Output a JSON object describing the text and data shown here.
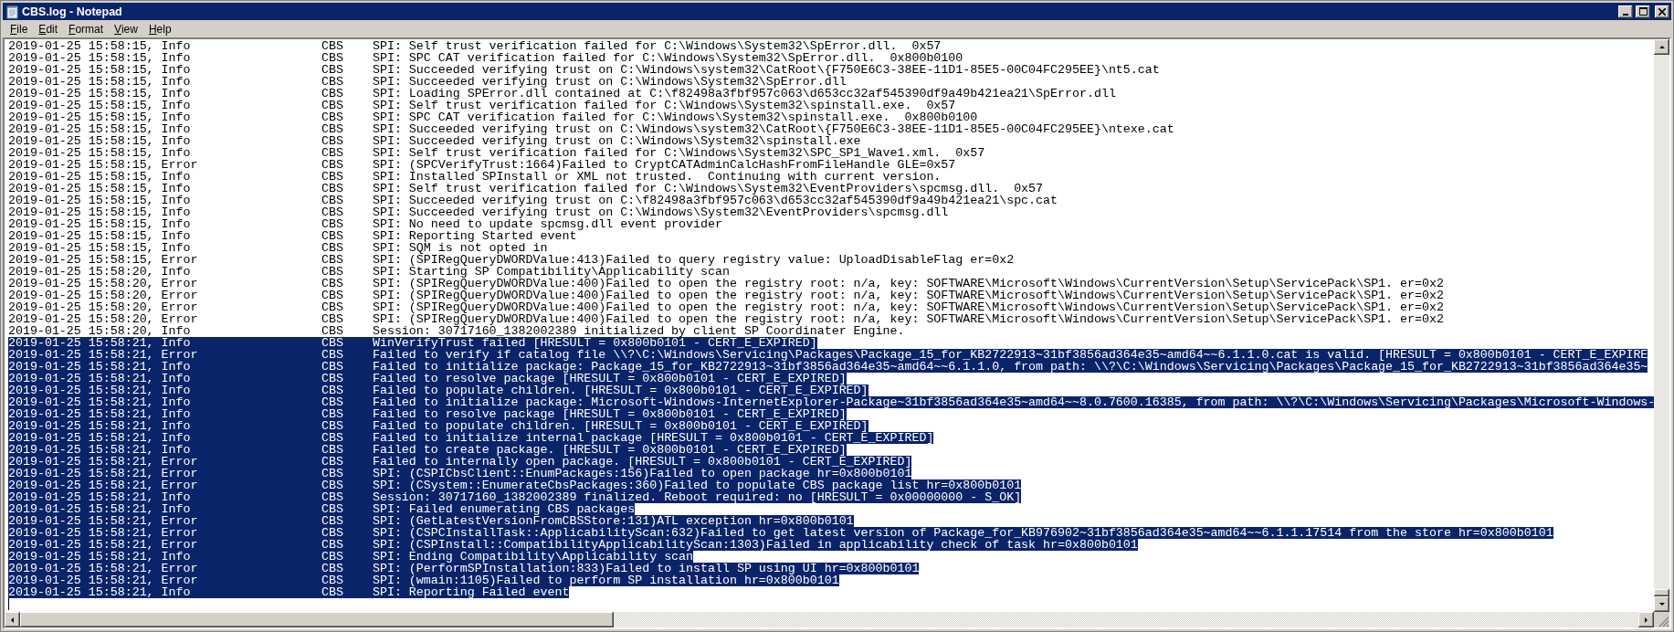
{
  "window": {
    "title": "CBS.log - Notepad"
  },
  "menu": [
    "File",
    "Edit",
    "Format",
    "View",
    "Help"
  ],
  "lines": [
    {
      "time": "2019-01-25 15:58:15,",
      "level": "Info",
      "source": "CBS",
      "message": "SPI: Self trust verification failed for C:\\Windows\\System32\\SpError.dll.  0x57",
      "selected": false
    },
    {
      "time": "2019-01-25 15:58:15,",
      "level": "Info",
      "source": "CBS",
      "message": "SPI: SPC CAT verification failed for C:\\Windows\\System32\\SpError.dll.  0x800b0100",
      "selected": false
    },
    {
      "time": "2019-01-25 15:58:15,",
      "level": "Info",
      "source": "CBS",
      "message": "SPI: Succeeded verifying trust on C:\\Windows\\system32\\CatRoot\\{F750E6C3-38EE-11D1-85E5-00C04FC295EE}\\nt5.cat",
      "selected": false
    },
    {
      "time": "2019-01-25 15:58:15,",
      "level": "Info",
      "source": "CBS",
      "message": "SPI: Succeeded verifying trust on C:\\Windows\\System32\\SpError.dll",
      "selected": false
    },
    {
      "time": "2019-01-25 15:58:15,",
      "level": "Info",
      "source": "CBS",
      "message": "SPI: Loading SPError.dll contained at C:\\f82498a3fbf957c063\\d653cc32af545390df9a49b421ea21\\SpError.dll",
      "selected": false
    },
    {
      "time": "2019-01-25 15:58:15,",
      "level": "Info",
      "source": "CBS",
      "message": "SPI: Self trust verification failed for C:\\Windows\\System32\\spinstall.exe.  0x57",
      "selected": false
    },
    {
      "time": "2019-01-25 15:58:15,",
      "level": "Info",
      "source": "CBS",
      "message": "SPI: SPC CAT verification failed for C:\\Windows\\System32\\spinstall.exe.  0x800b0100",
      "selected": false
    },
    {
      "time": "2019-01-25 15:58:15,",
      "level": "Info",
      "source": "CBS",
      "message": "SPI: Succeeded verifying trust on C:\\Windows\\system32\\CatRoot\\{F750E6C3-38EE-11D1-85E5-00C04FC295EE}\\ntexe.cat",
      "selected": false
    },
    {
      "time": "2019-01-25 15:58:15,",
      "level": "Info",
      "source": "CBS",
      "message": "SPI: Succeeded verifying trust on C:\\Windows\\System32\\spinstall.exe",
      "selected": false
    },
    {
      "time": "2019-01-25 15:58:15,",
      "level": "Info",
      "source": "CBS",
      "message": "SPI: Self trust verification failed for C:\\Windows\\System32\\SPC_SP1_Wave1.xml.  0x57",
      "selected": false
    },
    {
      "time": "2019-01-25 15:58:15,",
      "level": "Error",
      "source": "CBS",
      "message": "SPI: (SPCVerifyTrust:1664)Failed to CryptCATAdminCalcHashFromFileHandle GLE=0x57",
      "selected": false
    },
    {
      "time": "2019-01-25 15:58:15,",
      "level": "Info",
      "source": "CBS",
      "message": "SPI: Installed SPInstall or XML not trusted.  Continuing with current version.",
      "selected": false
    },
    {
      "time": "2019-01-25 15:58:15,",
      "level": "Info",
      "source": "CBS",
      "message": "SPI: Self trust verification failed for C:\\Windows\\System32\\EventProviders\\spcmsg.dll.  0x57",
      "selected": false
    },
    {
      "time": "2019-01-25 15:58:15,",
      "level": "Info",
      "source": "CBS",
      "message": "SPI: Succeeded verifying trust on C:\\f82498a3fbf957c063\\d653cc32af545390df9a49b421ea21\\spc.cat",
      "selected": false
    },
    {
      "time": "2019-01-25 15:58:15,",
      "level": "Info",
      "source": "CBS",
      "message": "SPI: Succeeded verifying trust on C:\\Windows\\System32\\EventProviders\\spcmsg.dll",
      "selected": false
    },
    {
      "time": "2019-01-25 15:58:15,",
      "level": "Info",
      "source": "CBS",
      "message": "SPI: No need to update spcmsg.dll event provider",
      "selected": false
    },
    {
      "time": "2019-01-25 15:58:15,",
      "level": "Info",
      "source": "CBS",
      "message": "SPI: Reporting Started event",
      "selected": false
    },
    {
      "time": "2019-01-25 15:58:15,",
      "level": "Info",
      "source": "CBS",
      "message": "SPI: SQM is not opted in",
      "selected": false
    },
    {
      "time": "2019-01-25 15:58:15,",
      "level": "Error",
      "source": "CBS",
      "message": "SPI: (SPIRegQueryDWORDValue:413)Failed to query registry value: UploadDisableFlag er=0x2",
      "selected": false
    },
    {
      "time": "2019-01-25 15:58:20,",
      "level": "Info",
      "source": "CBS",
      "message": "SPI: Starting SP Compatibility\\Applicability scan",
      "selected": false
    },
    {
      "time": "2019-01-25 15:58:20,",
      "level": "Error",
      "source": "CBS",
      "message": "SPI: (SPIRegQueryDWORDValue:400)Failed to open the registry root: n/a, key: SOFTWARE\\Microsoft\\Windows\\CurrentVersion\\Setup\\ServicePack\\SP1. er=0x2",
      "selected": false
    },
    {
      "time": "2019-01-25 15:58:20,",
      "level": "Error",
      "source": "CBS",
      "message": "SPI: (SPIRegQueryDWORDValue:400)Failed to open the registry root: n/a, key: SOFTWARE\\Microsoft\\Windows\\CurrentVersion\\Setup\\ServicePack\\SP1. er=0x2",
      "selected": false
    },
    {
      "time": "2019-01-25 15:58:20,",
      "level": "Error",
      "source": "CBS",
      "message": "SPI: (SPIRegQueryDWORDValue:400)Failed to open the registry root: n/a, key: SOFTWARE\\Microsoft\\Windows\\CurrentVersion\\Setup\\ServicePack\\SP1. er=0x2",
      "selected": false
    },
    {
      "time": "2019-01-25 15:58:20,",
      "level": "Error",
      "source": "CBS",
      "message": "SPI: (SPIRegQueryDWORDValue:400)Failed to open the registry root: n/a, key: SOFTWARE\\Microsoft\\Windows\\CurrentVersion\\Setup\\ServicePack\\SP1. er=0x2",
      "selected": false
    },
    {
      "time": "2019-01-25 15:58:20,",
      "level": "Info",
      "source": "CBS",
      "message": "Session: 30717160_1382002389 initialized by client SP Coordinater Engine.",
      "selected": false
    },
    {
      "time": "2019-01-25 15:58:21,",
      "level": "Info",
      "source": "CBS",
      "message": "WinVerifyTrust failed [HRESULT = 0x800b0101 - CERT_E_EXPIRED]",
      "selected": true
    },
    {
      "time": "2019-01-25 15:58:21,",
      "level": "Error",
      "source": "CBS",
      "message": "Failed to verify if catalog file \\\\?\\C:\\Windows\\Servicing\\Packages\\Package_15_for_KB2722913~31bf3856ad364e35~amd64~~6.1.1.0.cat is valid. [HRESULT = 0x800b0101 - CERT_E_EXPIRE",
      "selected": true
    },
    {
      "time": "2019-01-25 15:58:21,",
      "level": "Info",
      "source": "CBS",
      "message": "Failed to initialize package: Package_15_for_KB2722913~31bf3856ad364e35~amd64~~6.1.1.0, from path: \\\\?\\C:\\Windows\\Servicing\\Packages\\Package_15_for_KB2722913~31bf3856ad364e35~",
      "selected": true
    },
    {
      "time": "2019-01-25 15:58:21,",
      "level": "Info",
      "source": "CBS",
      "message": "Failed to resolve package [HRESULT = 0x800b0101 - CERT_E_EXPIRED]",
      "selected": true
    },
    {
      "time": "2019-01-25 15:58:21,",
      "level": "Info",
      "source": "CBS",
      "message": "Failed to populate children. [HRESULT = 0x800b0101 - CERT_E_EXPIRED]",
      "selected": true
    },
    {
      "time": "2019-01-25 15:58:21,",
      "level": "Info",
      "source": "CBS",
      "message": "Failed to initialize package: Microsoft-Windows-InternetExplorer-Package~31bf3856ad364e35~amd64~~8.0.7600.16385, from path: \\\\?\\C:\\Windows\\Servicing\\Packages\\Microsoft-Windows-",
      "selected": true
    },
    {
      "time": "2019-01-25 15:58:21,",
      "level": "Info",
      "source": "CBS",
      "message": "Failed to resolve package [HRESULT = 0x800b0101 - CERT_E_EXPIRED]",
      "selected": true
    },
    {
      "time": "2019-01-25 15:58:21,",
      "level": "Info",
      "source": "CBS",
      "message": "Failed to populate children. [HRESULT = 0x800b0101 - CERT_E_EXPIRED]",
      "selected": true
    },
    {
      "time": "2019-01-25 15:58:21,",
      "level": "Info",
      "source": "CBS",
      "message": "Failed to initialize internal package [HRESULT = 0x800b0101 - CERT_E_EXPIRED]",
      "selected": true
    },
    {
      "time": "2019-01-25 15:58:21,",
      "level": "Info",
      "source": "CBS",
      "message": "Failed to create package. [HRESULT = 0x800b0101 - CERT_E_EXPIRED]",
      "selected": true
    },
    {
      "time": "2019-01-25 15:58:21,",
      "level": "Error",
      "source": "CBS",
      "message": "Failed to internally open package. [HRESULT = 0x800b0101 - CERT_E_EXPIRED]",
      "selected": true
    },
    {
      "time": "2019-01-25 15:58:21,",
      "level": "Error",
      "source": "CBS",
      "message": "SPI: (CSPICbsClient::EnumPackages:156)Failed to open package hr=0x800b0101",
      "selected": true
    },
    {
      "time": "2019-01-25 15:58:21,",
      "level": "Error",
      "source": "CBS",
      "message": "SPI: (CSystem::EnumerateCbsPackages:360)Failed to populate CBS package list hr=0x800b0101",
      "selected": true
    },
    {
      "time": "2019-01-25 15:58:21,",
      "level": "Info",
      "source": "CBS",
      "message": "Session: 30717160_1382002389 finalized. Reboot required: no [HRESULT = 0x00000000 - S_OK]",
      "selected": true
    },
    {
      "time": "2019-01-25 15:58:21,",
      "level": "Info",
      "source": "CBS",
      "message": "SPI: Failed enumerating CBS packages",
      "selected": true
    },
    {
      "time": "2019-01-25 15:58:21,",
      "level": "Error",
      "source": "CBS",
      "message": "SPI: (GetLatestVersionFromCBSStore:131)ATL exception hr=0x800b0101",
      "selected": true
    },
    {
      "time": "2019-01-25 15:58:21,",
      "level": "Error",
      "source": "CBS",
      "message": "SPI: (CSPCInstallTask::ApplicabilityScan:632)Failed to get latest version of Package_for_KB976902~31bf3856ad364e35~amd64~~6.1.1.17514 from the store hr=0x800b0101",
      "selected": true
    },
    {
      "time": "2019-01-25 15:58:21,",
      "level": "Error",
      "source": "CBS",
      "message": "SPI: (CSPInstall::CompatibilityApplicabilityScan:1303)Failed in applicability check of task hr=0x800b0101",
      "selected": true
    },
    {
      "time": "2019-01-25 15:58:21,",
      "level": "Info",
      "source": "CBS",
      "message": "SPI: Ending Compatibility\\Applicability scan",
      "selected": true
    },
    {
      "time": "2019-01-25 15:58:21,",
      "level": "Error",
      "source": "CBS",
      "message": "SPI: (PerformSPInstallation:833)Failed to install SP using UI hr=0x800b0101",
      "selected": true
    },
    {
      "time": "2019-01-25 15:58:21,",
      "level": "Error",
      "source": "CBS",
      "message": "SPI: (wmain:1105)Failed to perform SP installation hr=0x800b0101",
      "selected": true
    },
    {
      "time": "2019-01-25 15:58:21,",
      "level": "Info",
      "source": "CBS",
      "message": "SPI: Reporting Failed event",
      "selected": true
    }
  ]
}
